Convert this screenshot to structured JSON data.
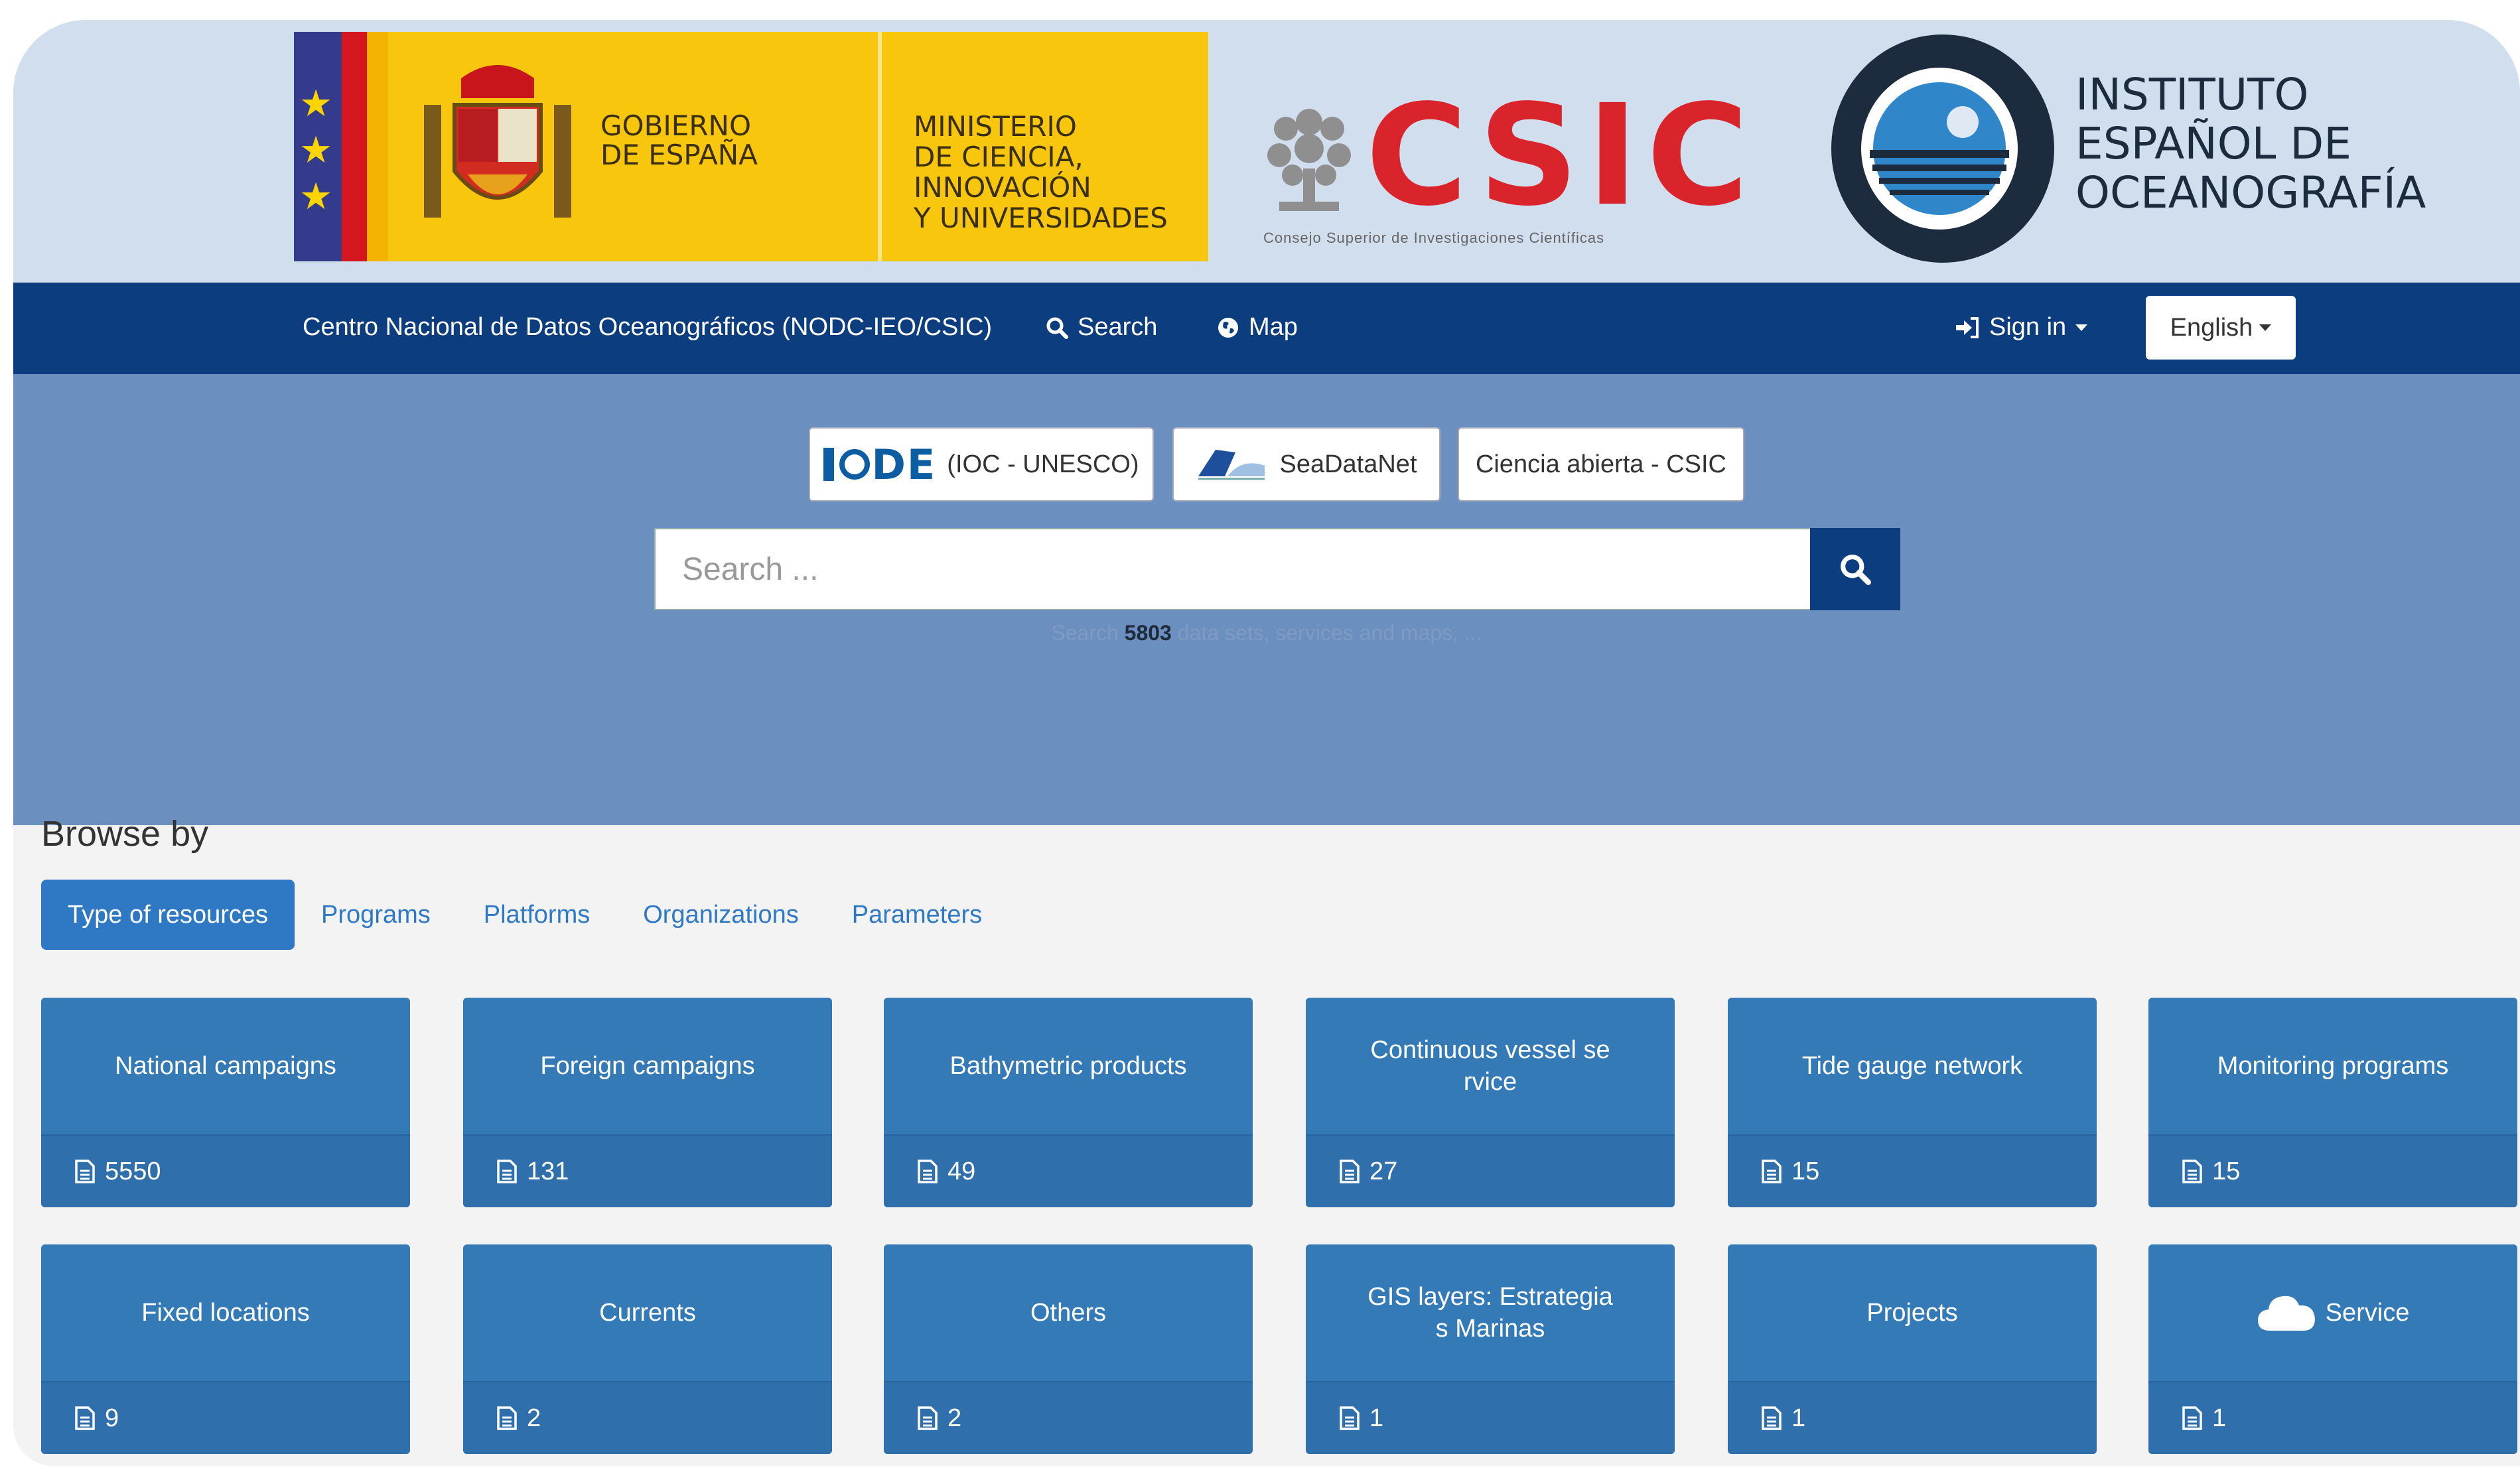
{
  "header": {
    "gov_line1": "GOBIERNO",
    "gov_line2": "DE ESPAÑA",
    "ministry_line1": "MINISTERIO",
    "ministry_line2": "DE CIENCIA, INNOVACIÓN",
    "ministry_line3": "Y UNIVERSIDADES",
    "csic_word": "CSIC",
    "csic_sub": "Consejo Superior de Investigaciones Científicas",
    "ieo_line1": "INSTITUTO",
    "ieo_line2": "ESPAÑOL DE",
    "ieo_line3": "OCEANOGRAFÍA"
  },
  "nav": {
    "brand": "Centro Nacional de Datos Oceanográficos (NODC-IEO/CSIC)",
    "search": "Search",
    "map": "Map",
    "signin": "Sign in",
    "language": "English"
  },
  "partners": {
    "iode_logo": "IODE",
    "iode_label": "(IOC - UNESCO)",
    "seadatanet": "SeaDataNet",
    "ciencia": "Ciencia abierta - CSIC"
  },
  "search": {
    "placeholder": "Search ...",
    "hint_prefix": "Search",
    "count": "5803",
    "hint_suffix": "data sets, services and maps, ..."
  },
  "browse": {
    "title": "Browse by",
    "tabs": [
      "Type of resources",
      "Programs",
      "Platforms",
      "Organizations",
      "Parameters"
    ],
    "tiles": [
      {
        "label": "National campaigns",
        "count": "5550"
      },
      {
        "label": "Foreign campaigns",
        "count": "131"
      },
      {
        "label": "Bathymetric products",
        "count": "49"
      },
      {
        "label": "Continuous vessel se rvice",
        "count": "27"
      },
      {
        "label": "Tide gauge network",
        "count": "15"
      },
      {
        "label": "Monitoring programs",
        "count": "15"
      },
      {
        "label": "Fixed locations",
        "count": "9"
      },
      {
        "label": "Currents",
        "count": "2"
      },
      {
        "label": "Others",
        "count": "2"
      },
      {
        "label": "GIS layers: Estrategia s Marinas",
        "count": "1"
      },
      {
        "label": "Projects",
        "count": "1"
      },
      {
        "label": "Service",
        "count": "1"
      }
    ]
  },
  "colors": {
    "navbar": "#0c3d7f",
    "hero": "#6b8fbe",
    "tile": "#337ab7",
    "csic_red": "#d9242b"
  }
}
